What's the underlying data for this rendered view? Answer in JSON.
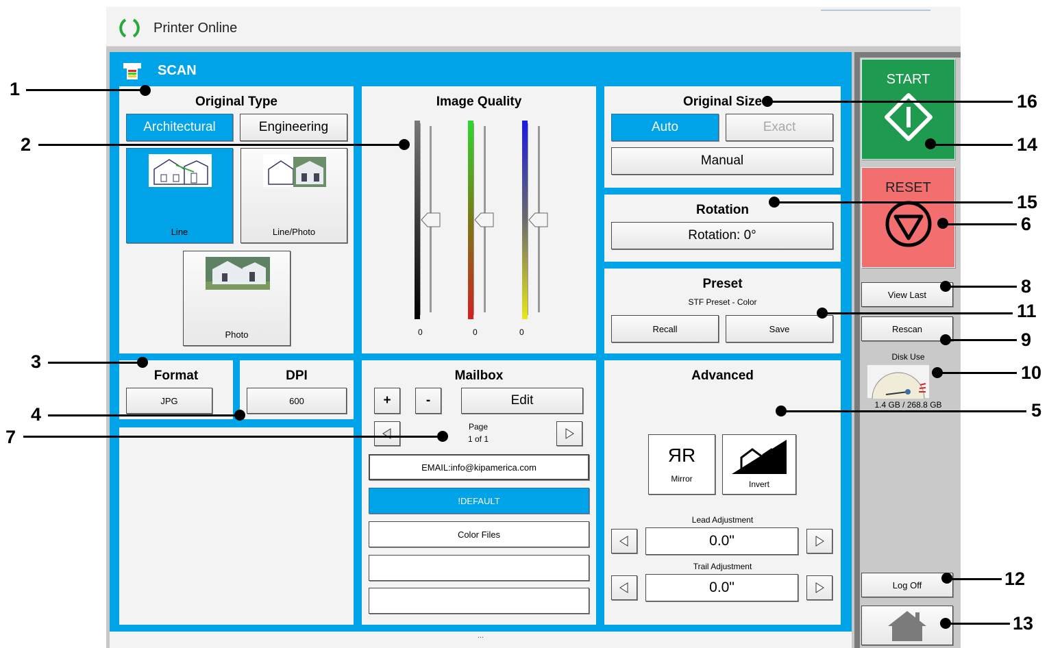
{
  "status": {
    "text": "Printer Online"
  },
  "header": {
    "title": "SCAN"
  },
  "original_type": {
    "title": "Original Type",
    "tabs": [
      "Architectural",
      "Engineering"
    ],
    "options": [
      "Line",
      "Line/Photo",
      "Photo"
    ]
  },
  "image_quality": {
    "title": "Image Quality",
    "values": [
      "0",
      "0",
      "0"
    ]
  },
  "original_size": {
    "title": "Original Size",
    "auto": "Auto",
    "exact": "Exact",
    "manual": "Manual"
  },
  "rotation": {
    "title": "Rotation",
    "button": "Rotation: 0°"
  },
  "preset": {
    "title": "Preset",
    "name": "STF Preset - Color",
    "recall": "Recall",
    "save": "Save"
  },
  "format": {
    "title": "Format",
    "value": "JPG"
  },
  "dpi": {
    "title": "DPI",
    "value": "600"
  },
  "mailbox": {
    "title": "Mailbox",
    "plus": "+",
    "minus": "-",
    "edit": "Edit",
    "page_label": "Page",
    "page_value": "1 of 1",
    "items": [
      "EMAIL:info@kipamerica.com",
      "!DEFAULT",
      "Color Files",
      "",
      ""
    ]
  },
  "advanced": {
    "title": "Advanced",
    "mirror": "Mirror",
    "mirror_glyph": "ЯR",
    "invert": "Invert",
    "lead_label": "Lead Adjustment",
    "lead_value": "0.0\"",
    "trail_label": "Trail Adjustment",
    "trail_value": "0.0\""
  },
  "sidebar": {
    "start": "START",
    "reset": "RESET",
    "view_last": "View Last",
    "rescan": "Rescan",
    "disk_label": "Disk Use",
    "disk_value": "1.4 GB / 268.8 GB",
    "log_off": "Log Off"
  },
  "footer": {
    "text": "..."
  },
  "callouts": [
    "1",
    "2",
    "3",
    "4",
    "7",
    "16",
    "14",
    "15",
    "6",
    "8",
    "11",
    "9",
    "10",
    "5",
    "12",
    "13"
  ],
  "colors": {
    "accent": "#00a2e8",
    "start": "#1e9b4f",
    "reset": "#f36f6f"
  }
}
